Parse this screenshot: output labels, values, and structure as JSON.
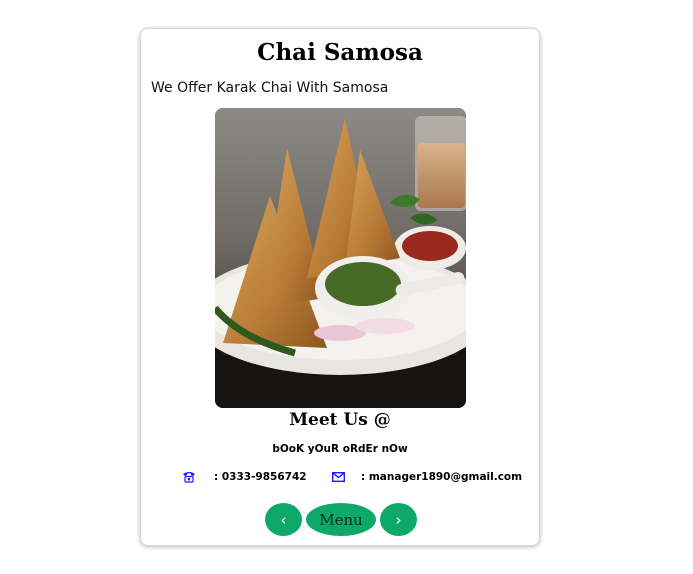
{
  "card": {
    "title": "Chai Samosa",
    "tagline": "We Offer Karak Chai With Samosa",
    "photo_alt": "Samosas with chai and chutney"
  },
  "contact": {
    "heading": "Meet Us @",
    "subheading": "bOoK yOuR oRdEr nOw",
    "phone_icon": "telephone-icon",
    "phone": ": 0333-9856742",
    "email_icon": "envelope-icon",
    "email": ": manager1890@gmail.com"
  },
  "nav": {
    "prev_label": "‹",
    "menu_label": "Menu",
    "next_label": "›"
  },
  "colors": {
    "accent": "#0ea86a",
    "icon": "#1a1aff"
  }
}
